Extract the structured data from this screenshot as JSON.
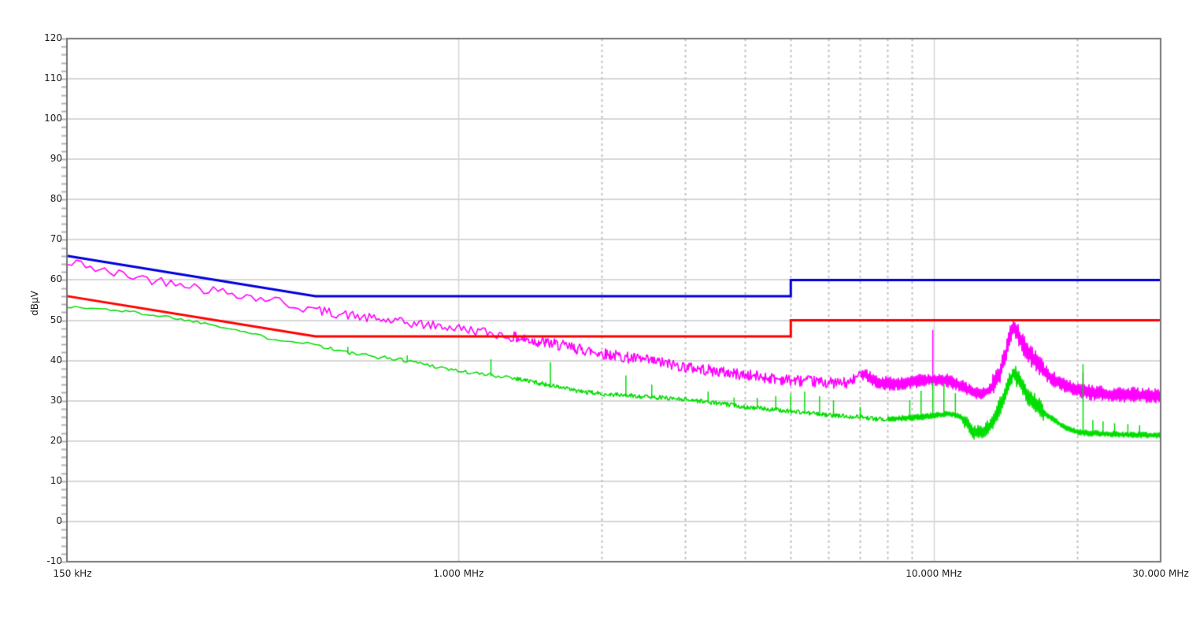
{
  "window": {
    "background": "#ffffff",
    "border_color": "#9a9a9a"
  },
  "chart_data": {
    "type": "line",
    "title": "",
    "ylabel": "dBµV",
    "x_axis": {
      "scale": "log",
      "min_mhz": 0.15,
      "max_mhz": 30,
      "tick_labels": [
        {
          "mhz": 0.15,
          "label": "150 kHz"
        },
        {
          "mhz": 1,
          "label": "1.000 MHz"
        },
        {
          "mhz": 10,
          "label": "10.000 MHz"
        },
        {
          "mhz": 30,
          "label": "30.000 MHz"
        }
      ],
      "major_gridlines_mhz": [
        1,
        10
      ],
      "minor_gridlines_mhz": [
        2,
        3,
        4,
        5,
        6,
        7,
        8,
        9,
        20
      ]
    },
    "y_axis": {
      "unit": "dBµV",
      "min": -10,
      "max": 120,
      "major_step": 10,
      "minor_step": 2,
      "tick_labels": [
        "120",
        "110",
        "100",
        "90",
        "80",
        "70",
        "60",
        "50",
        "40",
        "30",
        "20",
        "10",
        "0",
        "-10"
      ]
    },
    "grid": {
      "major_color": "#d7d7d7",
      "minor_color": "#c2c2c2",
      "tick_color": "#b2b2b2",
      "border_color": "#747474",
      "text_color": "#1c1c1c"
    },
    "series": [
      {
        "name": "quasi-peak-limit-line",
        "kind": "limit",
        "color": "#0000dd",
        "width": 3,
        "points_mhz_db": [
          [
            0.15,
            66
          ],
          [
            0.5,
            56
          ],
          [
            5,
            56
          ],
          [
            5,
            60
          ],
          [
            30,
            60
          ]
        ]
      },
      {
        "name": "average-limit-line",
        "kind": "limit",
        "color": "#ff0000",
        "width": 3,
        "points_mhz_db": [
          [
            0.15,
            56
          ],
          [
            0.5,
            46
          ],
          [
            5,
            46
          ],
          [
            5,
            50
          ],
          [
            30,
            50
          ]
        ]
      },
      {
        "name": "peak-measurement-trace",
        "kind": "trace",
        "color": "#ff00ff",
        "width": 1.6,
        "seed": 42,
        "anchors_mhz_db": [
          [
            0.15,
            63.6
          ],
          [
            0.162,
            64.3
          ],
          [
            0.175,
            62.3
          ],
          [
            0.195,
            61.4
          ],
          [
            0.214,
            60.7
          ],
          [
            0.24,
            59.6
          ],
          [
            0.259,
            59.8
          ],
          [
            0.28,
            58.2
          ],
          [
            0.313,
            57.2
          ],
          [
            0.35,
            56.6
          ],
          [
            0.38,
            55.2
          ],
          [
            0.4,
            55.6
          ],
          [
            0.43,
            54.2
          ],
          [
            0.486,
            52.8
          ],
          [
            0.53,
            52.0
          ],
          [
            0.586,
            51.3
          ],
          [
            0.64,
            50.6
          ],
          [
            0.7,
            50.0
          ],
          [
            0.78,
            49.3
          ],
          [
            0.9,
            48.6
          ],
          [
            1.0,
            48.0
          ],
          [
            1.15,
            47.0
          ],
          [
            1.3,
            45.8
          ],
          [
            1.45,
            44.8
          ],
          [
            1.6,
            44.0
          ],
          [
            1.8,
            42.8
          ],
          [
            2.0,
            41.8
          ],
          [
            2.3,
            40.6
          ],
          [
            2.6,
            39.7
          ],
          [
            3.0,
            38.4
          ],
          [
            3.5,
            37.3
          ],
          [
            4.0,
            36.4
          ],
          [
            4.5,
            35.7
          ],
          [
            5.0,
            35.1
          ],
          [
            5.5,
            34.8
          ],
          [
            6.0,
            34.5
          ],
          [
            6.6,
            34.3
          ],
          [
            7.1,
            36.8
          ],
          [
            7.6,
            34.4
          ],
          [
            8.2,
            34.2
          ],
          [
            9.0,
            34.7
          ],
          [
            10.0,
            35.2
          ],
          [
            10.6,
            35.1
          ],
          [
            11.2,
            34.2
          ],
          [
            11.8,
            32.8
          ],
          [
            12.2,
            31.9
          ],
          [
            12.7,
            31.6
          ],
          [
            13.2,
            33.0
          ],
          [
            13.8,
            37.0
          ],
          [
            14.2,
            42.0
          ],
          [
            14.45,
            45.5
          ],
          [
            14.7,
            48.3
          ],
          [
            15.0,
            46.5
          ],
          [
            15.4,
            44.0
          ],
          [
            16.0,
            41.0
          ],
          [
            16.6,
            38.8
          ],
          [
            17.3,
            36.6
          ],
          [
            18.0,
            35.0
          ],
          [
            19.0,
            33.4
          ],
          [
            20.0,
            32.6
          ],
          [
            21.5,
            31.9
          ],
          [
            23.0,
            31.6
          ],
          [
            25.0,
            31.5
          ],
          [
            27.0,
            31.4
          ],
          [
            30.0,
            31.2
          ]
        ],
        "noise_zones": [
          {
            "fmax": 0.5,
            "amp": 1.3,
            "step": 6
          },
          {
            "fmax": 1.3,
            "amp": 1.2,
            "step": 3
          },
          {
            "fmax": 7.0,
            "amp": 1.4,
            "step": 1
          },
          {
            "fmax": 11.5,
            "amp": 1.8,
            "step": 1,
            "comb": true
          },
          {
            "fmax": 13.3,
            "amp": 1.6,
            "step": 1,
            "comb": true
          },
          {
            "fmax": 17.0,
            "amp": 2.8,
            "step": 1,
            "comb": true
          },
          {
            "fmax": 30.0,
            "amp": 2.0,
            "step": 1,
            "comb": true
          }
        ],
        "spikes_mhz_db": [
          [
            9.95,
            47.6
          ],
          [
            20.6,
            37.0
          ]
        ]
      },
      {
        "name": "average-measurement-trace",
        "kind": "trace",
        "color": "#00dd00",
        "width": 1.5,
        "seed": 1337,
        "anchors_mhz_db": [
          [
            0.15,
            53.4
          ],
          [
            0.165,
            53.0
          ],
          [
            0.18,
            52.8
          ],
          [
            0.2,
            52.2
          ],
          [
            0.214,
            51.8
          ],
          [
            0.23,
            51.2
          ],
          [
            0.245,
            50.9
          ],
          [
            0.27,
            49.9
          ],
          [
            0.29,
            49.4
          ],
          [
            0.32,
            48.4
          ],
          [
            0.35,
            47.3
          ],
          [
            0.38,
            46.2
          ],
          [
            0.4,
            45.5
          ],
          [
            0.44,
            44.9
          ],
          [
            0.486,
            44.3
          ],
          [
            0.53,
            43.2
          ],
          [
            0.586,
            41.9
          ],
          [
            0.64,
            41.2
          ],
          [
            0.7,
            40.7
          ],
          [
            0.78,
            40.0
          ],
          [
            0.9,
            38.5
          ],
          [
            1.0,
            37.4
          ],
          [
            1.15,
            36.4
          ],
          [
            1.28,
            35.9
          ],
          [
            1.45,
            34.6
          ],
          [
            1.58,
            33.7
          ],
          [
            1.8,
            32.3
          ],
          [
            2.0,
            31.7
          ],
          [
            2.5,
            31.0
          ],
          [
            3.0,
            30.4
          ],
          [
            3.5,
            29.4
          ],
          [
            4.0,
            28.5
          ],
          [
            4.5,
            27.9
          ],
          [
            5.0,
            27.4
          ],
          [
            5.5,
            26.9
          ],
          [
            6.0,
            26.4
          ],
          [
            7.0,
            26.0
          ],
          [
            7.6,
            25.4
          ],
          [
            8.5,
            25.6
          ],
          [
            9.5,
            26.0
          ],
          [
            10.0,
            26.3
          ],
          [
            10.8,
            26.8
          ],
          [
            11.3,
            26.2
          ],
          [
            11.7,
            24.6
          ],
          [
            12.1,
            22.1
          ],
          [
            12.7,
            22.4
          ],
          [
            13.2,
            24.0
          ],
          [
            13.8,
            28.5
          ],
          [
            14.3,
            33.0
          ],
          [
            14.7,
            37.0
          ],
          [
            15.1,
            35.0
          ],
          [
            15.6,
            32.0
          ],
          [
            16.2,
            29.6
          ],
          [
            16.8,
            27.8
          ],
          [
            17.5,
            26.0
          ],
          [
            18.2,
            24.6
          ],
          [
            19.0,
            23.2
          ],
          [
            19.8,
            22.4
          ],
          [
            21.0,
            21.9
          ],
          [
            23.0,
            21.8
          ],
          [
            25.0,
            21.6
          ],
          [
            27.0,
            21.5
          ],
          [
            30.0,
            21.3
          ]
        ],
        "noise_zones": [
          {
            "fmax": 0.5,
            "amp": 0.35,
            "step": 5
          },
          {
            "fmax": 1.3,
            "amp": 0.5,
            "step": 3
          },
          {
            "fmax": 8.0,
            "amp": 0.55,
            "step": 1
          },
          {
            "fmax": 11.5,
            "amp": 0.8,
            "step": 1,
            "comb": true
          },
          {
            "fmax": 13.3,
            "amp": 1.8,
            "step": 1,
            "comb": true
          },
          {
            "fmax": 17.0,
            "amp": 2.6,
            "step": 1,
            "comb": true
          },
          {
            "fmax": 30.0,
            "amp": 0.8,
            "step": 1,
            "comb": true
          }
        ],
        "spikes_mhz_db": [
          [
            0.585,
            43.4
          ],
          [
            0.78,
            41.3
          ],
          [
            1.17,
            40.3
          ],
          [
            1.56,
            39.6
          ],
          [
            2.25,
            36.3
          ],
          [
            2.55,
            34.0
          ],
          [
            3.35,
            32.3
          ],
          [
            3.8,
            30.8
          ],
          [
            4.25,
            30.7
          ],
          [
            4.65,
            31.2
          ],
          [
            5.0,
            31.7
          ],
          [
            5.35,
            32.3
          ],
          [
            5.75,
            31.1
          ],
          [
            6.15,
            30.1
          ],
          [
            7.0,
            28.5
          ],
          [
            8.9,
            30.1
          ],
          [
            9.4,
            32.5
          ],
          [
            9.95,
            34.6
          ],
          [
            10.5,
            34.4
          ],
          [
            11.1,
            31.9
          ],
          [
            20.6,
            39.1
          ],
          [
            21.6,
            25.2
          ],
          [
            22.7,
            24.9
          ],
          [
            24.0,
            24.4
          ],
          [
            25.6,
            24.2
          ],
          [
            27.1,
            23.9
          ]
        ]
      }
    ]
  }
}
